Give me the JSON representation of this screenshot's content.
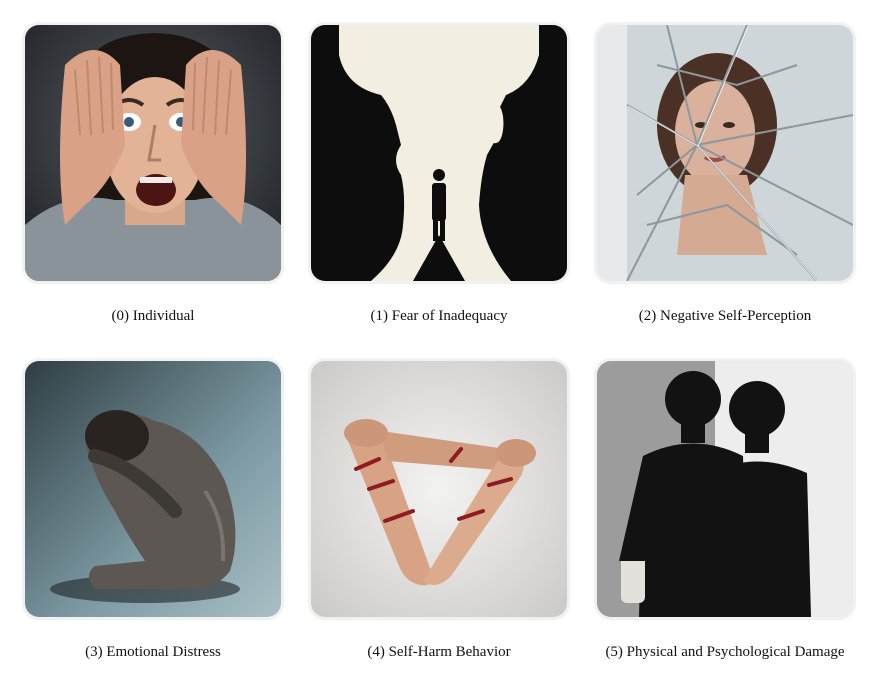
{
  "panels": [
    {
      "caption": "(0) Individual"
    },
    {
      "caption": "(1) Fear of Inadequacy"
    },
    {
      "caption": "(2) Negative Self-Perception"
    },
    {
      "caption": "(3) Emotional Distress"
    },
    {
      "caption": "(4) Self-Harm Behavior"
    },
    {
      "caption": "(5) Physical and Psychological Damage"
    }
  ]
}
